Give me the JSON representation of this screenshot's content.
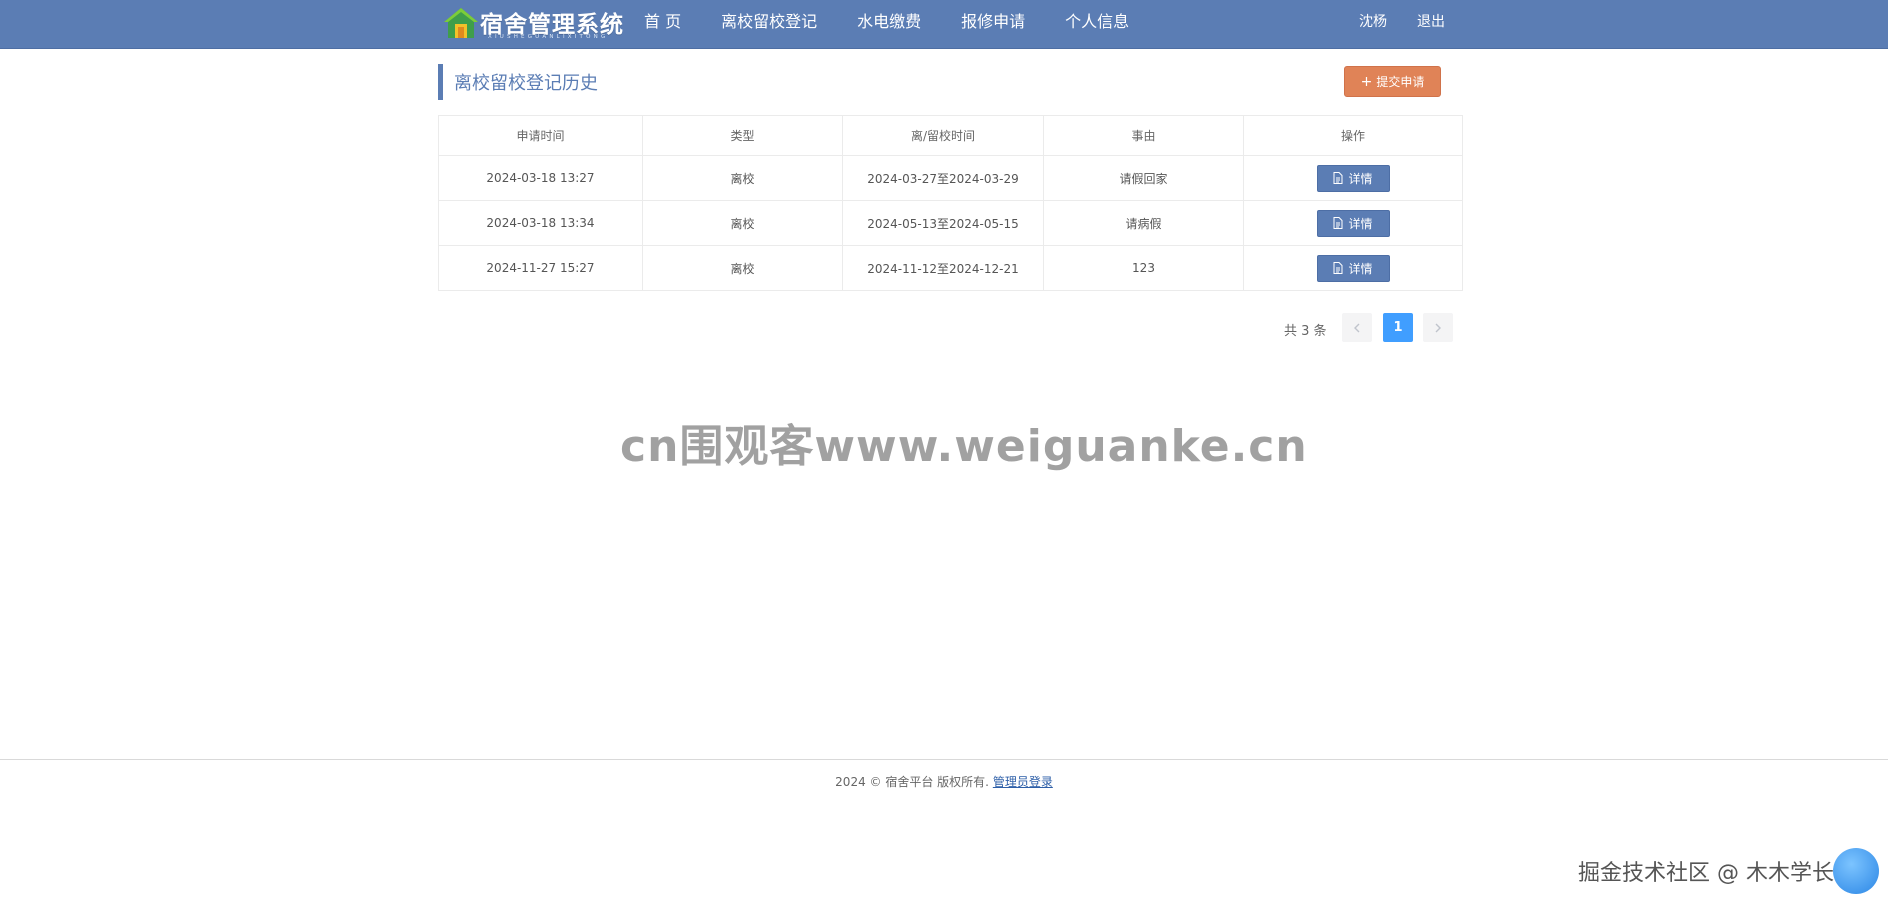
{
  "header": {
    "logo_text": "宿舍管理系统",
    "logo_sub": "XIUSHEGUANLIXITONG",
    "nav": [
      "首 页",
      "离校留校登记",
      "水电缴费",
      "报修申请",
      "个人信息"
    ],
    "user_name": "沈杨",
    "logout": "退出"
  },
  "page": {
    "title": "离校留校登记历史",
    "submit_label": "提交申请"
  },
  "table": {
    "headers": [
      "申请时间",
      "类型",
      "离/留校时间",
      "事由",
      "操作"
    ],
    "rows": [
      {
        "apply_time": "2024-03-18 13:27",
        "type": "离校",
        "period": "2024-03-27至2024-03-29",
        "reason": "请假回家",
        "action": "详情"
      },
      {
        "apply_time": "2024-03-18 13:34",
        "type": "离校",
        "period": "2024-05-13至2024-05-15",
        "reason": "请病假",
        "action": "详情"
      },
      {
        "apply_time": "2024-11-27 15:27",
        "type": "离校",
        "period": "2024-11-12至2024-12-21",
        "reason": "123",
        "action": "详情"
      }
    ]
  },
  "pagination": {
    "total_text": "共 3 条",
    "current_page": "1",
    "prev_icon": "chevron-left-icon",
    "next_icon": "chevron-right-icon"
  },
  "footer": {
    "text": "2024 © 宿舍平台 版权所有.",
    "admin_link": "管理员登录"
  },
  "overlays": {
    "watermark": "cn围观客www.weiguanke.cn",
    "corner_mark": "掘金技术社区 @ 木木学长"
  },
  "colors": {
    "nav_bg": "#5b7db4",
    "submit_bg": "#e08357",
    "detail_bg": "#5b7db4",
    "page_active": "#409eff"
  }
}
